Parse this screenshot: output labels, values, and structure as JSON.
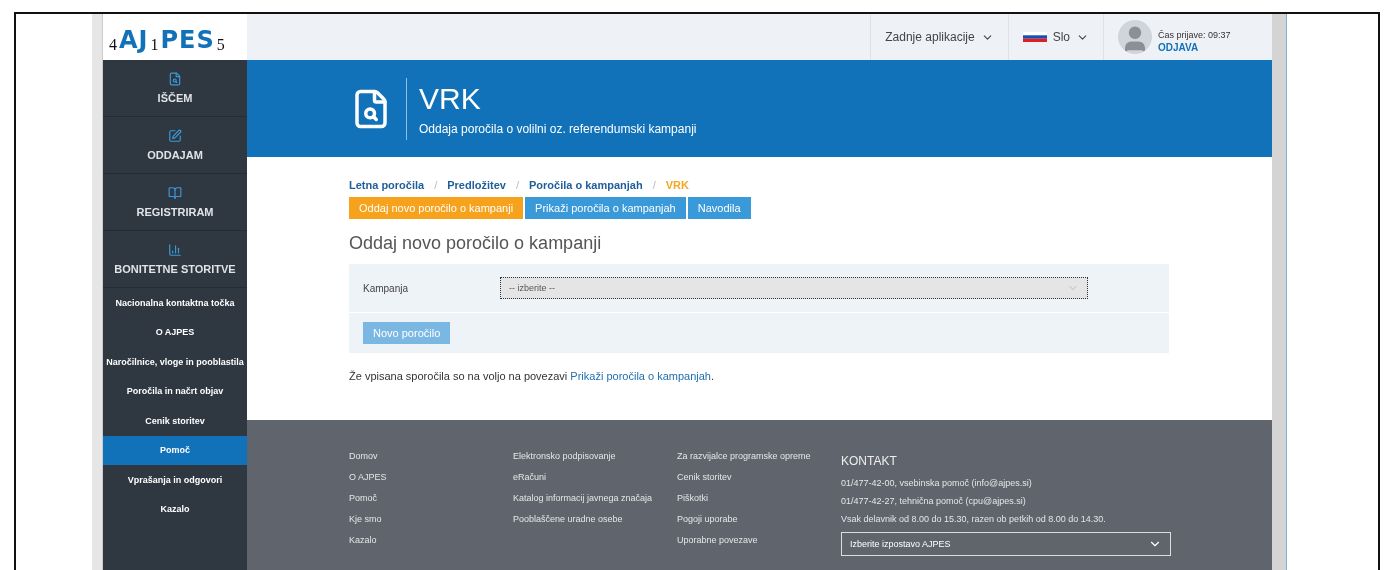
{
  "logo": {
    "parts": [
      "AJ",
      "PES"
    ],
    "callouts": [
      "4",
      "1",
      "5"
    ]
  },
  "topbar": {
    "recent_apps": "Zadnje aplikacije",
    "language": "Slo",
    "login_time": "Čas prijave: 09:37",
    "logout": "ODJAVA"
  },
  "sidebar": {
    "main_items": [
      {
        "label": "IŠČEM",
        "kind": "search"
      },
      {
        "label": "ODDAJAM",
        "kind": "edit"
      },
      {
        "label": "REGISTRIRAM",
        "kind": "book"
      },
      {
        "label": "BONITETNE STORITVE",
        "kind": "chart"
      }
    ],
    "items": [
      {
        "label": "Nacionalna kontaktna točka",
        "selected": false
      },
      {
        "label": "O AJPES",
        "selected": false
      },
      {
        "label": "Naročilnice, vloge in pooblastila",
        "selected": false
      },
      {
        "label": "Poročila in načrt objav",
        "selected": false
      },
      {
        "label": "Cenik storitev",
        "selected": false
      },
      {
        "label": "Pomoč",
        "selected": true
      },
      {
        "label": "Vprašanja in odgovori",
        "selected": false
      },
      {
        "label": "Kazalo",
        "selected": false
      }
    ]
  },
  "banner": {
    "title": "VRK",
    "subtitle": "Oddaja poročila o volilni oz. referendumski kampanji"
  },
  "breadcrumb": [
    {
      "label": "Letna poročila",
      "selected": false
    },
    {
      "separator": "/",
      "label": "Predložitev",
      "selected": false
    },
    {
      "separator": "/",
      "label": "Poročila o kampanjah",
      "selected": false
    },
    {
      "separator": "/",
      "label": "VRK",
      "selected": true
    }
  ],
  "actions": [
    {
      "label": "Oddaj novo poročilo o kampanji",
      "selected": true
    },
    {
      "label": "Prikaži poročila o kampanjah",
      "selected": false
    },
    {
      "label": "Navodila",
      "selected": false
    }
  ],
  "heading": "Oddaj novo poročilo o kampanji",
  "form": {
    "label": "Kampanja",
    "select_value": "-- izberite --",
    "button": "Novo poročilo",
    "button_disabled": true
  },
  "note": {
    "text": "Že vpisana sporočila so na voljo na povezavi",
    "link": "Prikaži poročila o kampanjah",
    "end": "."
  },
  "footer": {
    "columns": [
      [
        "Domov",
        "O AJPES",
        "Pomoč",
        "Kje smo",
        "Kazalo"
      ],
      [
        "Elektronsko podpisovanje",
        "eRačuni",
        "Katalog informacij javnega značaja",
        "Pooblaščene uradne osebe"
      ],
      [
        "Za razvijalce programske opreme",
        "Cenik storitev",
        "Piškotki",
        "Pogoji uporabe",
        "Uporabne povezave"
      ]
    ],
    "contact_title": "KONTAKT",
    "contact_lines": [
      "01/477-42-00, vsebinska pomoč (info@ajpes.si)",
      "01/477-42-27, tehnična pomoč (cpu@ajpes.si)",
      "Vsak delavnik od 8.00 do 15.30, razen ob petkih od 8.00 do 14.30."
    ],
    "branch_select": "Izberite izpostavo AJPES"
  }
}
